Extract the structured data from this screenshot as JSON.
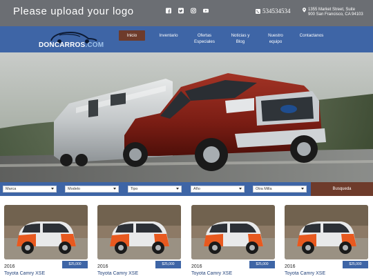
{
  "header": {
    "logo_placeholder": "Please upload your logo",
    "socials": [
      "facebook-icon",
      "twitter-icon",
      "instagram-icon",
      "youtube-icon"
    ],
    "phone": "534534534",
    "address_line1": "1355 Market Street, Suite",
    "address_line2": "900 San Francisco, CA 94103"
  },
  "nav": {
    "brand": "DONCARROS",
    "brand_suffix": ".COM",
    "items": [
      {
        "line1": "Inicio",
        "line2": ""
      },
      {
        "line1": "Inventario",
        "line2": ""
      },
      {
        "line1": "Ofertas",
        "line2": "Especiales"
      },
      {
        "line1": "Noticias y",
        "line2": "Blog"
      },
      {
        "line1": "Nuestro",
        "line2": "equipo"
      },
      {
        "line1": "Contactanos",
        "line2": ""
      }
    ]
  },
  "search": {
    "fields": [
      "Marca",
      "Modelo",
      "Tipo",
      "Año",
      "Otra Milla"
    ],
    "button": "Busqueda"
  },
  "listings": [
    {
      "year": "2016",
      "price": "$25,000",
      "model": "Toyota Camry XSE"
    },
    {
      "year": "2016",
      "price": "$25,000",
      "model": "Toyota Camry XSE"
    },
    {
      "year": "2016",
      "price": "$25,000",
      "model": "Toyota Camry XSE"
    },
    {
      "year": "2016",
      "price": "$25,000",
      "model": "Toyota Camry XSE"
    }
  ],
  "colors": {
    "topbar": "#6b6e73",
    "nav_blue": "#3e65a6",
    "accent_brown": "#6e3b2b",
    "truck_red": "#7a1d14"
  }
}
